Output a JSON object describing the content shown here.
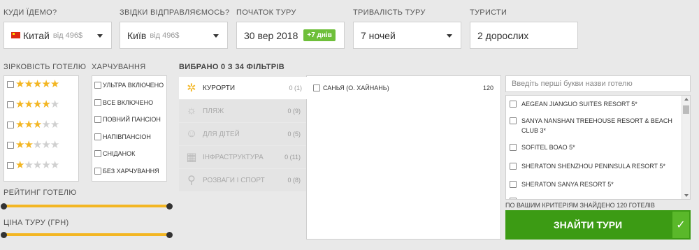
{
  "header": {
    "destination": {
      "label": "КУДИ ЇДЕМО?",
      "value": "Китай",
      "sub": "від 496$"
    },
    "departure": {
      "label": "ЗВІДКИ ВІДПРАВЛЯЄМОСЬ?",
      "value": "Київ",
      "sub": "від 496$"
    },
    "start": {
      "label": "ПОЧАТОК ТУРУ",
      "value": "30 вер 2018",
      "badge": "+7 днів"
    },
    "duration": {
      "label": "ТРИВАЛІСТЬ ТУРУ",
      "value": "7 ночей"
    },
    "tourists": {
      "label": "ТУРИСТИ",
      "value": "2 дорослих"
    }
  },
  "stars": {
    "label": "ЗІРКОВІСТЬ ГОТЕЛЮ",
    "levels": [
      5,
      4,
      3,
      2,
      1
    ]
  },
  "meals": {
    "label": "ХАРЧУВАННЯ",
    "items": [
      "УЛЬТРА ВКЛЮЧЕНО",
      "ВСЕ ВКЛЮЧЕНО",
      "ПОВНИЙ ПАНСІОН",
      "НАПІВПАНСІОН",
      "СНІДАНОК",
      "БЕЗ ХАРЧУВАННЯ"
    ]
  },
  "rating": {
    "label": "РЕЙТИНГ ГОТЕЛЮ"
  },
  "price": {
    "label": "ЦІНА ТУРУ (ГРН)"
  },
  "filters": {
    "label": "ВИБРАНО 0 З 34 ФІЛЬТРІВ",
    "tabs": [
      {
        "label": "КУРОРТИ",
        "count": "0 (1)",
        "icon": "palm-icon"
      },
      {
        "label": "ПЛЯЖ",
        "count": "0 (9)",
        "icon": "beach-icon"
      },
      {
        "label": "ДЛЯ ДІТЕЙ",
        "count": "0 (5)",
        "icon": "child-icon"
      },
      {
        "label": "ІНФРАСТРУКТУРА",
        "count": "0 (11)",
        "icon": "building-icon"
      },
      {
        "label": "РОЗВАГИ І СПОРТ",
        "count": "0 (8)",
        "icon": "sport-icon"
      }
    ],
    "resort": {
      "name": "САНЬЯ (О. ХАЙНАНЬ)",
      "count": "120"
    }
  },
  "hotels": {
    "placeholder": "Введіть перші букви назви готелю",
    "items": [
      "AEGEAN JIANGUO SUITES RESORT 5*",
      "SANYA NANSHAN TREEHOUSE RESORT & BEACH CLUB 3*",
      "SOFITEL BOAO 5*",
      "SHERATON SHENZHOU PENINSULA RESORT 5*",
      "SHERATON SANYA RESORT 5*"
    ],
    "found": "ПО ВАШИМ КРИТЕРІЯМ ЗНАЙДЕНО 120 ГОТЕЛІВ"
  },
  "search_button": "ЗНАЙТИ ТУРИ",
  "colors": {
    "accent": "#f3b623",
    "green": "#3c9b14",
    "badge": "#6ebf3a"
  }
}
